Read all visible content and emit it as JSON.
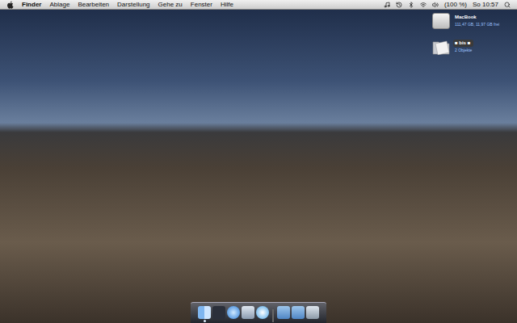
{
  "menu_bar": {
    "app": "Finder",
    "menus": [
      "Ablage",
      "Bearbeiten",
      "Darstellung",
      "Gehe zu",
      "Fenster",
      "Hilfe"
    ],
    "battery": "(100 %)",
    "clock": "So 10:57"
  },
  "wallpaper": {
    "kind": "photo"
  },
  "desktop_icons": [
    {
      "name": "MacBook",
      "info": "111,47 GB, 11,97 GB frei",
      "kind": "disk",
      "selected": false
    },
    {
      "name": "■ bis ■",
      "info": "2 Objekte",
      "kind": "folder",
      "selected": true
    }
  ],
  "dock": {
    "items": [
      {
        "kind": "finder",
        "running": true
      },
      {
        "kind": "dashboard",
        "running": false
      },
      {
        "kind": "safari",
        "running": false
      },
      {
        "kind": "mail",
        "running": false
      },
      {
        "kind": "itunes",
        "running": false
      },
      {
        "kind": "separator",
        "running": false
      },
      {
        "kind": "folder",
        "running": false
      },
      {
        "kind": "folder",
        "running": false
      },
      {
        "kind": "trash",
        "running": false
      }
    ]
  }
}
